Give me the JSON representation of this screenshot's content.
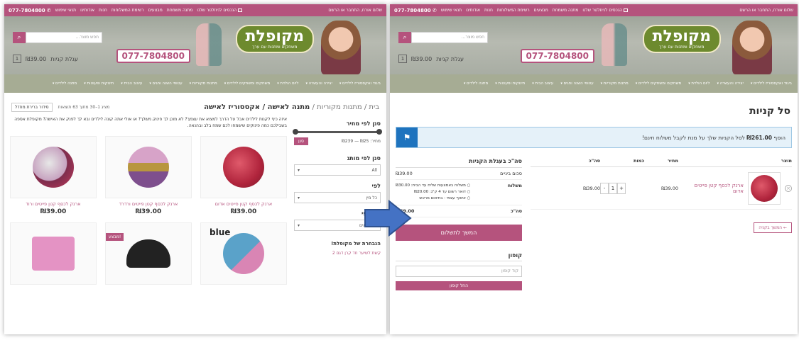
{
  "topbar": {
    "greeting": "שלום אורח, התחבר או הרשם",
    "links": [
      "הנכסים לניוזלטר שלנו",
      "מתנה משמחת",
      "מבצעים",
      "רשימת המשלוחות",
      "חנות",
      "אודותינו",
      "תנאי שימוש"
    ],
    "phone": "077-7804800"
  },
  "banner": {
    "logo_name": "מקופלת",
    "logo_tag": "משחקים ומתנות עם ערך",
    "phone": "077-7804800",
    "search_placeholder": "חפש מוצר...",
    "search_icon": "search-icon",
    "cart_label": "עגלת קניות",
    "cart_total": "₪39.00",
    "cart_count": "1"
  },
  "nav": [
    "ביגוד ואקססוריז לילדים",
    "יצירה והעשרה",
    "ליום הולדת",
    "משחקים ומשחקים לילדים",
    "מתנות מקוריות",
    "עטופי השנה וחגים",
    "עיצוב הבית",
    "תינוקות ופעוטות",
    "מתנה לילדים"
  ],
  "left": {
    "crumb_home": "בית",
    "crumb_mid": "מתנות מקוריות",
    "crumb_current": "מתנה לאישה / אקססוריז לאישה",
    "result_count": "מציג 1–30 מתוך 63 תוצאות",
    "sort": "סידור ברירת מחדל",
    "intro": "איזה כיף לקנות לילדים אבל על הדרך למצוא את עצמך? לא מוכן לך פינוק משלך? או אולי אתה קונה לילדים ובא לך לפנק את האישה? מקופלת אספה בשבילכם כמה פינוקים שישמחו לכם שמח בלב ובהנאה.",
    "filter_price": "סנן לפי מחיר",
    "price_range": "מחיר: ₪25 — ₪239",
    "filter_btn": "סנן",
    "filter_brand": "סנן לפי מותג",
    "brand_value": "All",
    "filter_type": "לפי",
    "type_value": "כל מין",
    "filter_gender": "סנן לפי",
    "gender_value": "כל גילאים",
    "promo_title": "הנבחרת של מקופלת!",
    "promo_item": "קשת לשיער חד קרן דגם 2",
    "sale_badge": "!מבצע",
    "blue_label": "blue",
    "products": [
      {
        "name": "ארנק לכסף קטן פייטים אדום",
        "price": "₪39.00"
      },
      {
        "name": "ארנק לכסף קטן פייטים ורדרד",
        "price": "₪39.00"
      },
      {
        "name": "ארנק לכסף קטן פייטים ורוד",
        "price": "₪39.00"
      }
    ]
  },
  "right": {
    "title": "סל קניות",
    "notice_pre": "הוסף",
    "notice_amount": "₪261.00",
    "notice_post": "לסל הקניות שלך על מנת לקבל משלוח חינם!",
    "col_product": "מוצר",
    "col_price": "מחיר",
    "col_qty": "כמות",
    "col_subtotal": "סה\"כ",
    "item_name": "ארנק לכסף קטן פייטים אדום",
    "item_price": "₪39.00",
    "item_qty": "1",
    "item_subtotal": "₪39.00",
    "continue": "← המשך בקניה",
    "totals_title": "סה\"כ בעגלת הקניות",
    "subtotal_label": "סכום ביניים",
    "subtotal_value": "₪39.00",
    "shipping_label": "משלוח",
    "ship_opts": [
      "משלוח באמצעות שליח עד הבית: ₪30.00",
      "דואר רשום עד 4 ק\"ג: ₪20.00",
      "איסוף עצמי - בתיאום מראש"
    ],
    "total_label": "סה\"כ",
    "total_value": "₪69.00",
    "checkout": "המשך לתשלום",
    "coupon_title": "קופון",
    "coupon_placeholder": "קוד קופון",
    "coupon_btn": "החל קופון"
  },
  "colors": {
    "brand": "#b5537d",
    "nav": "#a6ac94",
    "notice": "#1e73be",
    "arrow": "#4472c4"
  }
}
